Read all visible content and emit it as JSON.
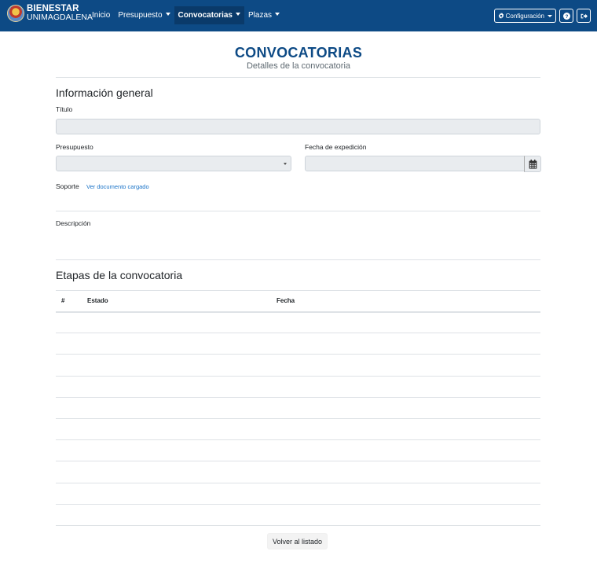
{
  "brand": {
    "line1": "BIENESTAR",
    "line2": "UNIMAGDALENA"
  },
  "nav": {
    "items": [
      {
        "label": "Inicio"
      },
      {
        "label": "Presupuesto"
      },
      {
        "label": "Convocatorias"
      },
      {
        "label": "Plazas"
      }
    ],
    "active": "Convocatorias",
    "config_label": "Configuración",
    "help_icon": "question-circle-icon",
    "logout_icon": "sign-out-icon"
  },
  "page": {
    "title": "CONVOCATORIAS",
    "subtitle": "Detalles de la convocatoria"
  },
  "general": {
    "heading": "Información general",
    "title_label": "Título",
    "title_value": "",
    "budget_label": "Presupuesto",
    "budget_value": "",
    "date_label": "Fecha de expedición",
    "date_value": "",
    "support_label": "Soporte",
    "support_link": "Ver documento cargado",
    "description_label": "Descripción",
    "description_value": ""
  },
  "stages": {
    "heading": "Etapas de la convocatoria",
    "columns": [
      "#",
      "Estado",
      "Fecha"
    ],
    "rows": [
      {
        "num": "",
        "estado": "",
        "fecha": ""
      },
      {
        "num": "",
        "estado": "",
        "fecha": ""
      },
      {
        "num": "",
        "estado": "",
        "fecha": ""
      },
      {
        "num": "",
        "estado": "",
        "fecha": ""
      },
      {
        "num": "",
        "estado": "",
        "fecha": ""
      },
      {
        "num": "",
        "estado": "",
        "fecha": ""
      },
      {
        "num": "",
        "estado": "",
        "fecha": ""
      },
      {
        "num": "",
        "estado": "",
        "fecha": ""
      },
      {
        "num": "",
        "estado": "",
        "fecha": ""
      },
      {
        "num": "",
        "estado": "",
        "fecha": ""
      }
    ]
  },
  "back_label": "Volver al listado",
  "colors": {
    "primary": "#0d4a85",
    "link": "#1a73c8"
  }
}
